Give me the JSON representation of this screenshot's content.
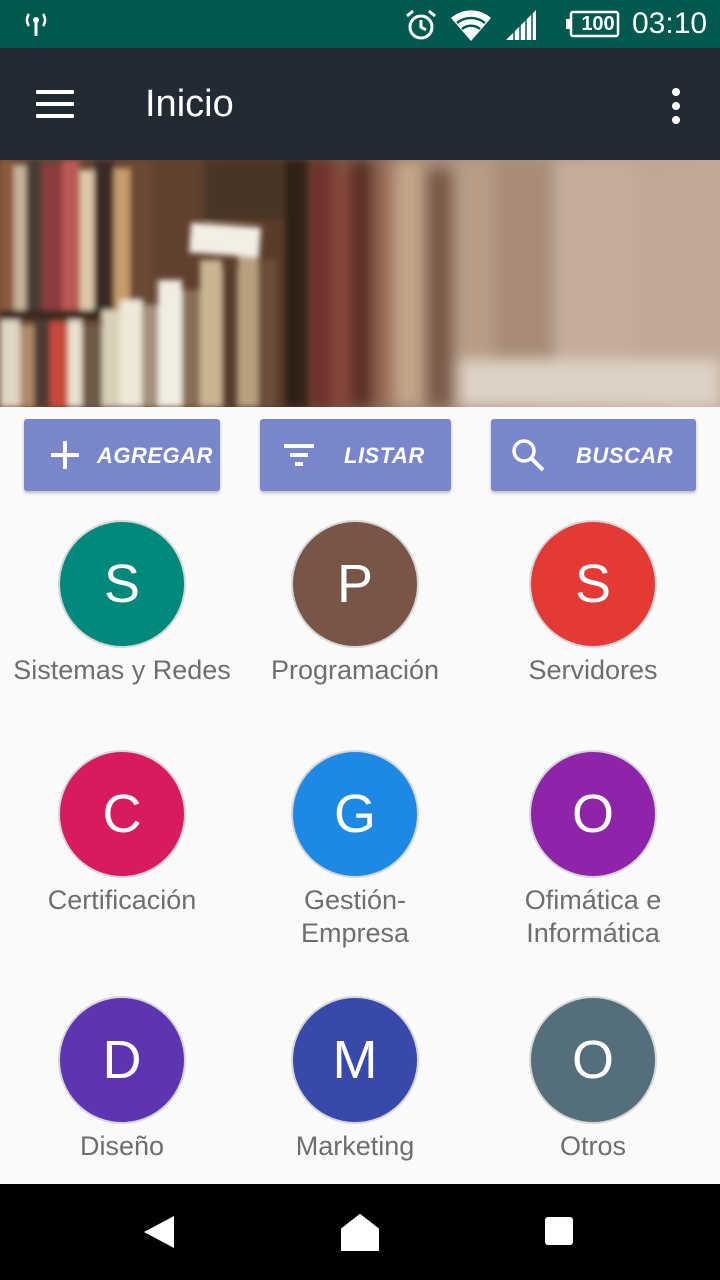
{
  "status_bar": {
    "battery": "100",
    "time": "03:10",
    "icons": [
      "antenna-icon",
      "alarm-icon",
      "wifi-icon",
      "signal-icon",
      "battery-icon"
    ]
  },
  "app_bar": {
    "title": "Inicio",
    "icons": [
      "menu-icon",
      "more-vert-icon"
    ]
  },
  "actions": [
    {
      "label": "AGREGAR",
      "icon": "plus-icon"
    },
    {
      "label": "LISTAR",
      "icon": "filter-list-icon"
    },
    {
      "label": "BUSCAR",
      "icon": "search-icon"
    }
  ],
  "categories": [
    {
      "letter": "S",
      "label": "Sistemas y Redes",
      "color": "#00897b"
    },
    {
      "letter": "P",
      "label": "Programación",
      "color": "#795548"
    },
    {
      "letter": "S",
      "label": "Servidores",
      "color": "#e53935"
    },
    {
      "letter": "C",
      "label": "Certificación",
      "color": "#d81b60"
    },
    {
      "letter": "G",
      "label": "Gestión-\nEmpresa",
      "color": "#1e88e5"
    },
    {
      "letter": "O",
      "label": "Ofimática e\nInformática",
      "color": "#8e24aa"
    },
    {
      "letter": "D",
      "label": "Diseño",
      "color": "#5e35b1"
    },
    {
      "letter": "M",
      "label": "Marketing",
      "color": "#3949ab"
    },
    {
      "letter": "O",
      "label": "Otros",
      "color": "#546e7a"
    }
  ],
  "nav_bar": {
    "icons": [
      "back-icon",
      "home-icon",
      "recents-icon"
    ]
  },
  "colors": {
    "status_bar": "#00594f",
    "app_bar": "#222a33",
    "button": "#7986cb"
  }
}
